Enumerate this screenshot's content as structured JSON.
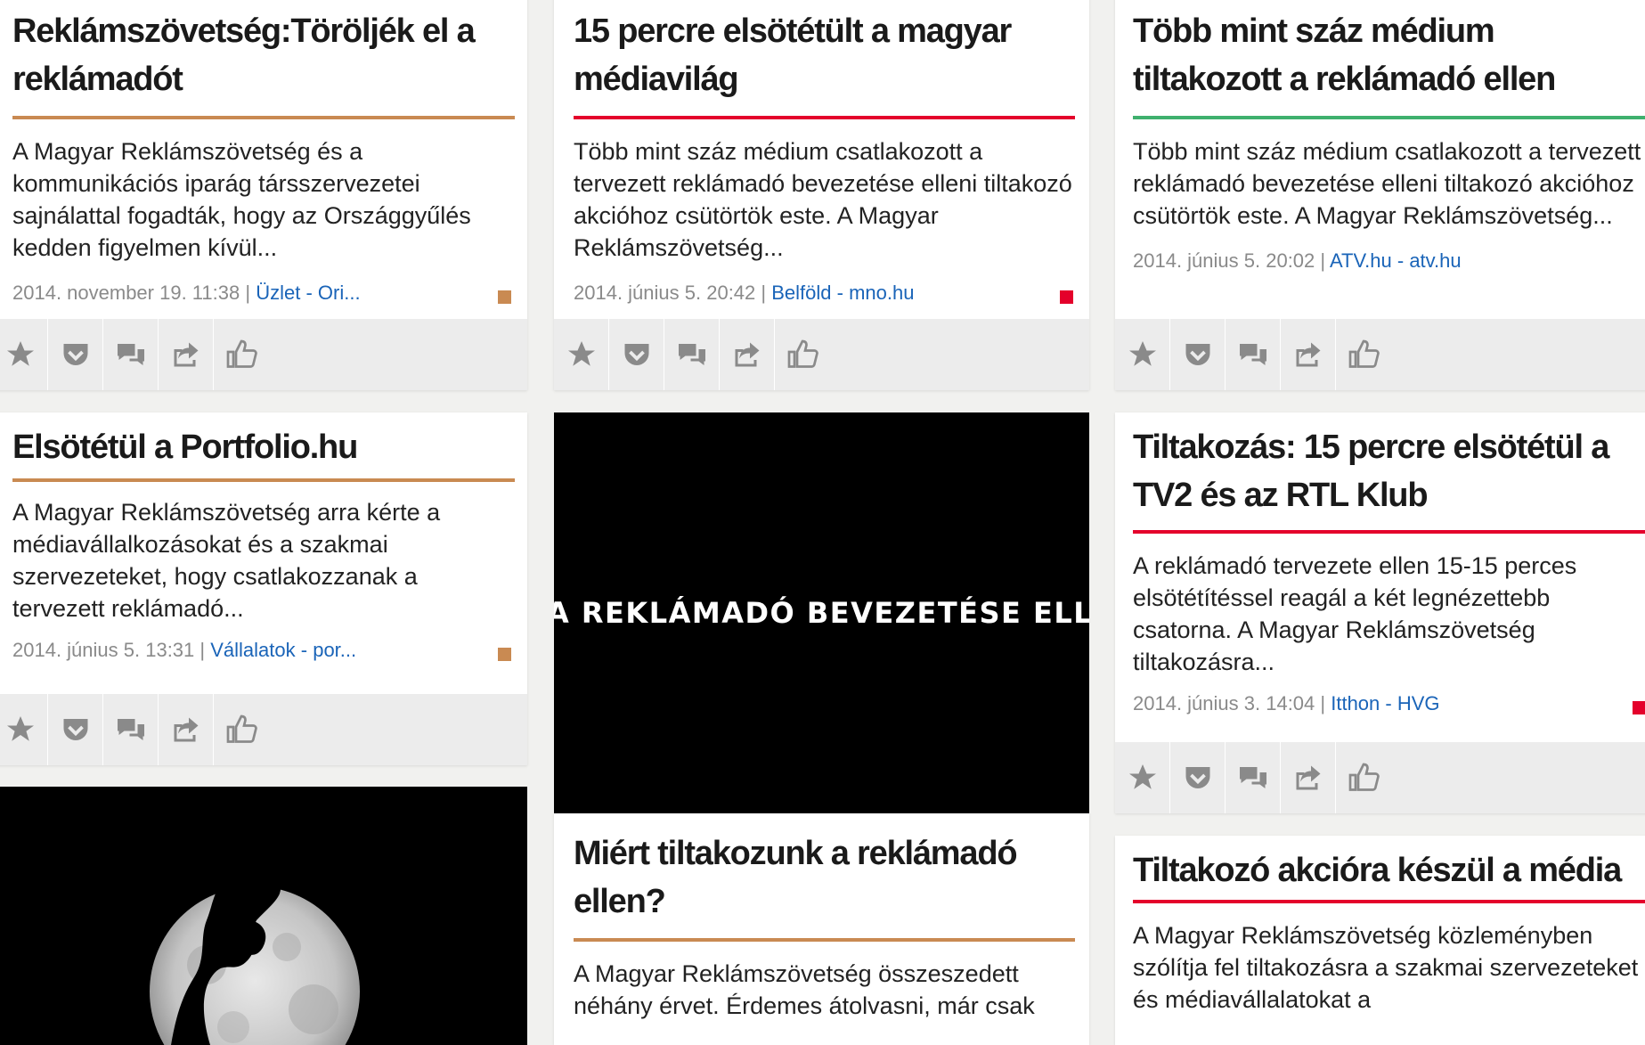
{
  "colors": {
    "tan": "#c98a52",
    "red": "#e4002b",
    "green": "#3fb06e",
    "link": "#1a64b8"
  },
  "toolbar_icons": [
    "star-icon",
    "pocket-icon",
    "comments-icon",
    "share-icon",
    "like-icon"
  ],
  "cards": [
    {
      "title": "Reklámszövetség:Töröljék el a reklámadót",
      "excerpt": "A Magyar Reklámszövetség és a kommunikációs iparág társszervezetei sajnálattal fogadták, hogy az Országgyűlés kedden figyelmen kívül...",
      "date": "2014. november 19. 11:38",
      "category": "Üzlet",
      "source": "Ori...",
      "accent": "#c98a52"
    },
    {
      "title": "15 percre elsötétült a magyar médiavilág",
      "excerpt": "Több mint száz médium csatlakozott a tervezett reklámadó bevezetése elleni tiltakozó akcióhoz csütörtök este. A Magyar Reklámszövetség...",
      "date": "2014. június 5. 20:42",
      "category": "Belföld",
      "source": "mno.hu",
      "accent": "#e4002b"
    },
    {
      "title": "Több mint száz médium tiltakozott a reklámadó ellen",
      "excerpt": "Több mint száz médium csatlakozott a tervezett reklámadó bevezetése elleni tiltakozó akcióhoz csütörtök este. A Magyar Reklámszövetség...",
      "date": "2014. június 5. 20:02",
      "category": "ATV.hu",
      "source": "atv.hu",
      "accent": "#3fb06e"
    },
    {
      "title": "Elsötétül a Portfolio.hu",
      "excerpt": "A Magyar Reklámszövetség arra kérte a médiavállalkozásokat és a szakmai szervezeteket, hogy csatlakozzanak a tervezett reklámadó...",
      "date": "2014. június 5. 13:31",
      "category": "Vállalatok",
      "source": "por...",
      "accent": "#c98a52"
    },
    {
      "title": "Tiltakozás: 15 percre elsötétül a TV2 és az RTL Klub",
      "excerpt": "A reklámadó tervezete ellen 15-15 perces elsötétítéssel reagál a két legnézettebb csatorna. A Magyar Reklámszövetség tiltakozásra...",
      "date": "2014. június 3. 14:04",
      "category": "Itthon",
      "source": "HVG",
      "accent": "#e4002b"
    },
    {
      "title": "Miért tiltakozunk a reklámadó ellen?",
      "excerpt": "A Magyar Reklámszövetség összeszedett néhány érvet. Érdemes átolvasni, már csak",
      "accent": "#c98a52"
    },
    {
      "title": "Tiltakozó akcióra készül a média",
      "excerpt": "A Magyar Reklámszövetség közleményben szólítja fel tiltakozásra a szakmai szervezeteket és médiavállalatokat a",
      "accent": "#e4002b"
    }
  ],
  "banner": {
    "text": "A REKLÁMADÓ BEVEZETÉSE ELLEN!"
  }
}
